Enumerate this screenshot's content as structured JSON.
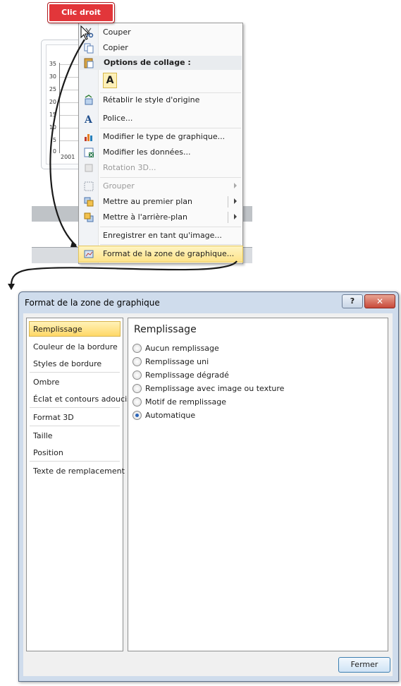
{
  "callout": {
    "label": "Clic droit"
  },
  "chart_snippet": {
    "ticks": [
      "35",
      "30",
      "25",
      "20",
      "15",
      "10",
      "5",
      "0"
    ],
    "xlabel": "2001"
  },
  "context_menu": {
    "items": [
      {
        "label": "Couper",
        "icon": "scissors-icon",
        "disabled": false
      },
      {
        "label": "Copier",
        "icon": "copy-icon",
        "disabled": false
      }
    ],
    "paste_header": "Options de collage :",
    "paste_option": "A",
    "items2": [
      {
        "label": "Rétablir le style d'origine",
        "icon": "reset-style-icon",
        "disabled": false
      },
      {
        "label": "Police...",
        "icon": "font-icon",
        "disabled": false
      },
      {
        "label": "Modifier le type de graphique...",
        "icon": "chart-type-icon",
        "disabled": false
      },
      {
        "label": "Modifier les données...",
        "icon": "edit-data-icon",
        "disabled": false
      },
      {
        "label": "Rotation 3D...",
        "icon": "rotation-3d-icon",
        "disabled": true
      },
      {
        "label": "Grouper",
        "icon": "group-icon",
        "disabled": true,
        "submenu": true
      },
      {
        "label": "Mettre au premier plan",
        "icon": "bring-front-icon",
        "disabled": false,
        "submenu": true
      },
      {
        "label": "Mettre à l'arrière-plan",
        "icon": "send-back-icon",
        "disabled": false,
        "submenu": true
      },
      {
        "label": "Enregistrer en tant qu'image...",
        "disabled": false
      },
      {
        "label": "Format de la zone de graphique...",
        "icon": "format-chart-area-icon",
        "disabled": false,
        "highlighted": true
      }
    ]
  },
  "dialog": {
    "title": "Format de la zone de graphique",
    "help_label": "?",
    "close_label": "✕",
    "nav": [
      "Remplissage",
      "Couleur de la bordure",
      "Styles de bordure",
      "Ombre",
      "Éclat et contours adoucis",
      "Format 3D",
      "Taille",
      "Position",
      "Texte de remplacement"
    ],
    "selected_nav": "Remplissage",
    "section_title": "Remplissage",
    "options": [
      {
        "label": "Aucun remplissage",
        "checked": false
      },
      {
        "label": "Remplissage uni",
        "checked": false
      },
      {
        "label": "Remplissage dégradé",
        "checked": false
      },
      {
        "label": "Remplissage avec image ou texture",
        "checked": false
      },
      {
        "label": "Motif de remplissage",
        "checked": false
      },
      {
        "label": "Automatique",
        "checked": true
      }
    ],
    "close_button": "Fermer"
  },
  "colors": {
    "callout": "#e2363a",
    "highlight": "#fde38a",
    "radio_on": "#2a64b8"
  }
}
